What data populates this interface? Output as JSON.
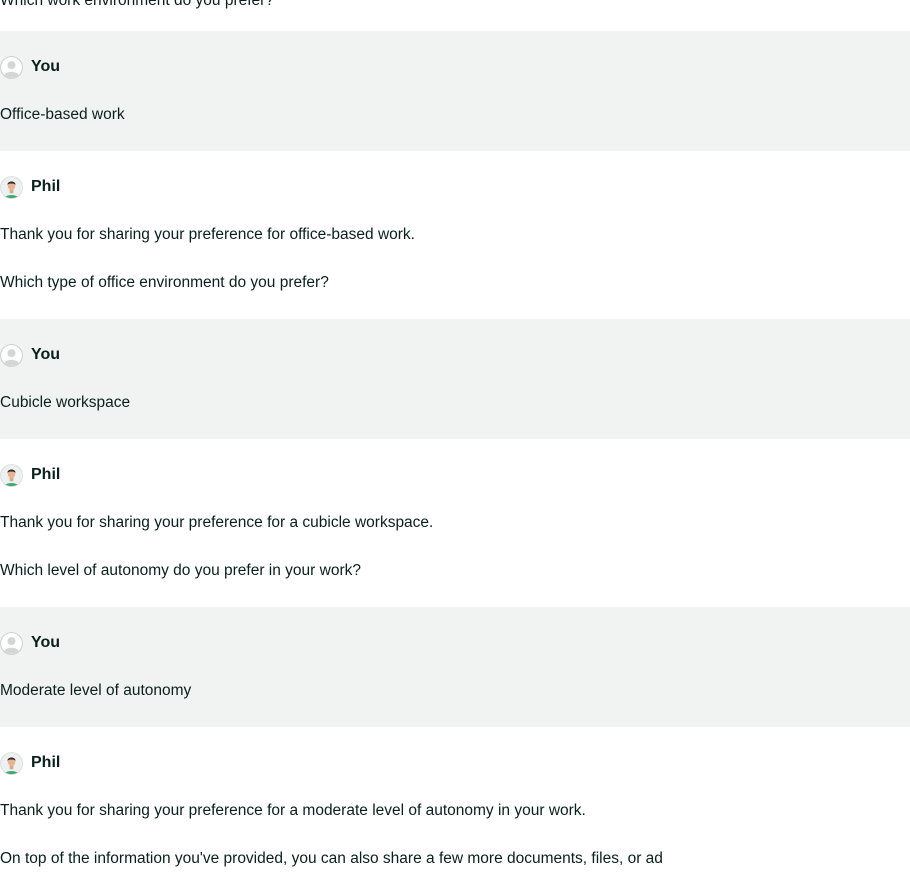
{
  "conversation": {
    "previous_question": "Which work environment do you prefer?",
    "messages": [
      {
        "sender": "You",
        "avatar_icon": "default-user-avatar-icon",
        "lines": [
          "Office-based work"
        ]
      },
      {
        "sender": "Phil",
        "avatar_icon": "phil-avatar-icon",
        "lines": [
          "Thank you for sharing your preference for office-based work.",
          "Which type of office environment do you prefer?"
        ]
      },
      {
        "sender": "You",
        "avatar_icon": "default-user-avatar-icon",
        "lines": [
          "Cubicle workspace"
        ]
      },
      {
        "sender": "Phil",
        "avatar_icon": "phil-avatar-icon",
        "lines": [
          "Thank you for sharing your preference for a cubicle workspace.",
          "Which level of autonomy do you prefer in your work?"
        ]
      },
      {
        "sender": "You",
        "avatar_icon": "default-user-avatar-icon",
        "lines": [
          "Moderate level of autonomy"
        ]
      },
      {
        "sender": "Phil",
        "avatar_icon": "phil-avatar-icon",
        "lines": [
          "Thank you for sharing your preference for a moderate level of autonomy in your work.",
          "On top of the information you've provided, you can also share a few more documents, files, or ad"
        ]
      }
    ]
  },
  "colors": {
    "user_message_bg": "#f1f3f2",
    "bot_message_bg": "#ffffff",
    "text": "#0b1f1c",
    "phil_shirt": "#3aa57f"
  }
}
